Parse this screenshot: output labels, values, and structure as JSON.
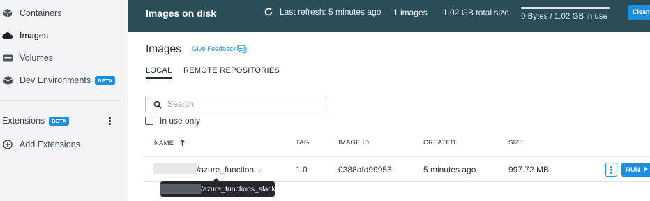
{
  "sidebar": {
    "items": [
      {
        "label": "Containers",
        "icon": "container-icon",
        "active": false
      },
      {
        "label": "Images",
        "icon": "cloud-icon",
        "active": true
      },
      {
        "label": "Volumes",
        "icon": "volume-icon",
        "active": false
      },
      {
        "label": "Dev Environments",
        "icon": "dev-env-icon",
        "active": false,
        "badge": "BETA"
      }
    ],
    "extensions": {
      "label": "Extensions",
      "badge": "BETA"
    },
    "add_extensions": {
      "label": "Add Extensions",
      "icon": "plus-circle-icon"
    }
  },
  "header": {
    "title": "Images on disk",
    "refresh": "Last refresh: 5 minutes ago",
    "count": "1 images",
    "total_size": "1.02 GB total size",
    "usage_text": "0 Bytes / 1.02 GB in use",
    "usage_fraction": 0.0,
    "clean_label": "Clean"
  },
  "main": {
    "title": "Images",
    "feedback": "Give Feedback",
    "tabs": [
      {
        "label": "LOCAL",
        "active": true
      },
      {
        "label": "REMOTE REPOSITORIES",
        "active": false
      }
    ],
    "search_placeholder": "Search",
    "in_use_only": "In use only",
    "columns": [
      "NAME",
      "TAG",
      "IMAGE ID",
      "CREATED",
      "SIZE"
    ],
    "rows": [
      {
        "name": "/azure_function...",
        "tag": "1.0",
        "image_id": "0388afd99953",
        "created": "5 minutes ago",
        "size": "997.72 MB"
      }
    ],
    "tooltip": "/azure_functions_slack",
    "run_label": "RUN"
  },
  "colors": {
    "accent": "#1d8fe0",
    "header_bg": "#2b4d58",
    "sidebar_bg": "#f4f4f6"
  }
}
